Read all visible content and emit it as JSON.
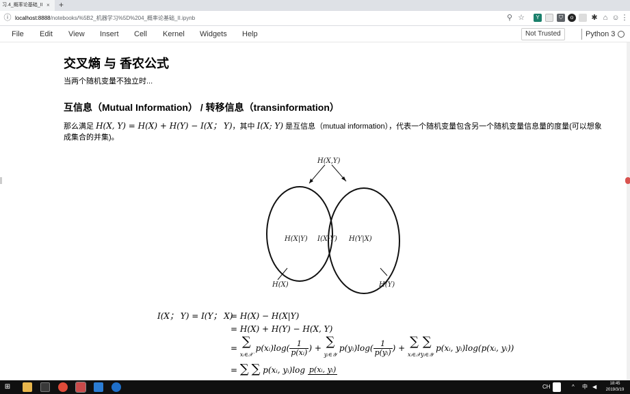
{
  "browser": {
    "tab_title": "习.4_概率论基础_II",
    "tab_close": "×",
    "new_tab": "+",
    "url_host": "localhost:8888",
    "url_path": "/notebooks/%5B2_机器学习%5D%204_概率论基础_II.ipynb",
    "icons": [
      "back-icon",
      "info-icon",
      "zoom-icon",
      "star-icon"
    ]
  },
  "menubar": {
    "items": [
      "File",
      "Edit",
      "View",
      "Insert",
      "Cell",
      "Kernel",
      "Widgets",
      "Help"
    ],
    "trust_label": "Not Trusted",
    "kernel_name": "Python 3"
  },
  "notebook": {
    "h1": "交叉熵 与 香农公式",
    "p1": "当两个随机变量不独立时...",
    "h2": "互信息（Mutual Information） / 转移信息（transinformation）",
    "para_prefix": "那么满足",
    "para_formula": "H(X, Y) = H(X) + H(Y) − I(X； Y)",
    "para_mid": "，其中",
    "para_term": "I(X; Y)",
    "para_suffix": "是互信息（mutual information），代表一个随机变量包含另一个随机变量信息量的度量(可以想象",
    "para_line2": "成集合的并集)。",
    "venn": {
      "top_label": "H(X,Y)",
      "left_label": "H(X|Y)",
      "center_label": "I(X;Y)",
      "right_label": "H(Y|X)",
      "bottom_left_label": "H(X)",
      "bottom_right_label": "H(Y)"
    },
    "equations": {
      "line1_lhs": "I(X； Y) = I(Y； X)",
      "line1_rhs": "= H(X) − H(X|Y)",
      "line2_rhs": "= H(X) + H(Y) − H(X, Y)",
      "line3_eq": "=",
      "sum_sign": "∑",
      "line3_sub1": "xᵢ∈𝒳",
      "line3_t1": "p(xᵢ)log(",
      "line3_frac1_num": "1",
      "line3_frac1_den": "p(xᵢ)",
      "line3_plus1": ") +",
      "line3_sub2": "yᵢ∈𝒴",
      "line3_t2": "p(yᵢ)log(",
      "line3_frac2_num": "1",
      "line3_frac2_den": "p(yᵢ)",
      "line3_plus2": ") +",
      "line3_sub3": "xᵢ∈𝒳",
      "line3_sub4": "yᵢ∈𝒴",
      "line3_t3": "p(xᵢ, yᵢ)log(p(xᵢ, yᵢ))",
      "line4_eq": "=",
      "line4_t": "p(xᵢ, yᵢ)log",
      "line4_frac_num": "p(xᵢ, yᵢ)"
    }
  },
  "taskbar": {
    "lang": "CH",
    "ime": "中",
    "time": "18:45",
    "date": "2019/3/19"
  }
}
